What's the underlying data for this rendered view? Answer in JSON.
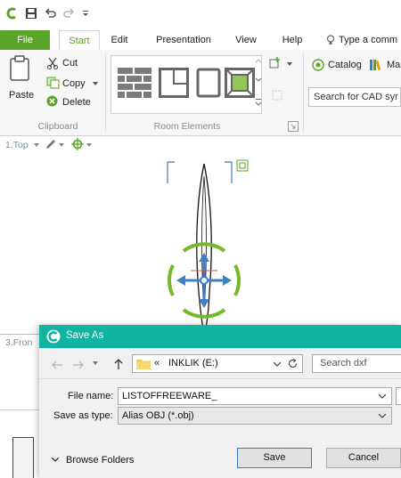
{
  "quick_access": {
    "icons": [
      "app-logo-icon",
      "save-icon",
      "undo-icon",
      "redo-icon",
      "customize-dropdown-icon"
    ]
  },
  "tabs": [
    {
      "label": "File"
    },
    {
      "label": "Start"
    },
    {
      "label": "Edit"
    },
    {
      "label": "Presentation"
    },
    {
      "label": "View"
    },
    {
      "label": "Help"
    }
  ],
  "command_search": {
    "label": "Type a comm"
  },
  "ribbon": {
    "paste_label": "Paste",
    "cut_label": "Cut",
    "copy_label": "Copy",
    "delete_label": "Delete",
    "clipboard_group": "Clipboard",
    "room_elements_group": "Room Elements",
    "catalog_label": "Catalog",
    "ma_label": "Ma",
    "cad_search_placeholder": "Search for CAD syr"
  },
  "viewport": {
    "top_view_label": "1.Top",
    "front_view_label": "3.Fron"
  },
  "dialog": {
    "title": "Save As",
    "breadcrumb_prefix": "«",
    "breadcrumb_path": "INKLIK (E:)",
    "search_placeholder": "Search dxf",
    "filename_label": "File name:",
    "filename_value": "LISTOFFREEWARE_",
    "savetype_label": "Save as type:",
    "savetype_value": "Alias OBJ (*.obj)",
    "browse_folders_label": "Browse Folders",
    "save_label": "Save",
    "cancel_label": "Cancel"
  },
  "colors": {
    "accent_green": "#5aa42a",
    "dialog_teal": "#12b3a0",
    "gizmo_blue": "#3f7fc4",
    "gizmo_green": "#76b82a"
  }
}
